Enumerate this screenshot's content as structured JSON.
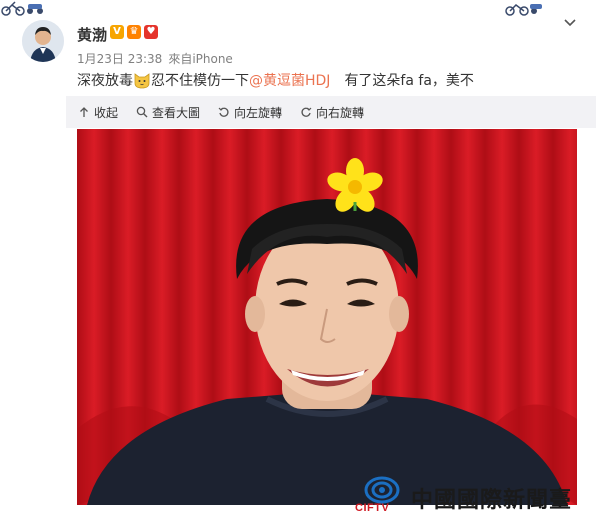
{
  "post": {
    "username": "黄渤",
    "badges": [
      "V",
      "♛",
      "♥"
    ],
    "timestamp": "1月23日 23:38",
    "source": "來自iPhone",
    "text_before": "深夜放毒",
    "text_after_emoji": "忍不住模仿一下",
    "mention": "@黄逗菌HDJ",
    "text_end": "有了这朵fa fa，美不"
  },
  "toolbar": {
    "collapse": "收起",
    "view_large": "查看大圖",
    "rotate_left": "向左旋轉",
    "rotate_right": "向右旋轉"
  },
  "watermark": {
    "text": "中國國際新聞臺",
    "sub": "CIFTV"
  },
  "colors": {
    "accent_link": "#eb7350",
    "toolbar_bg": "#f2f2f5",
    "curtain_red": "#c8101a",
    "logo_blue": "#1b6fc2",
    "logo_red": "#d01c25"
  }
}
